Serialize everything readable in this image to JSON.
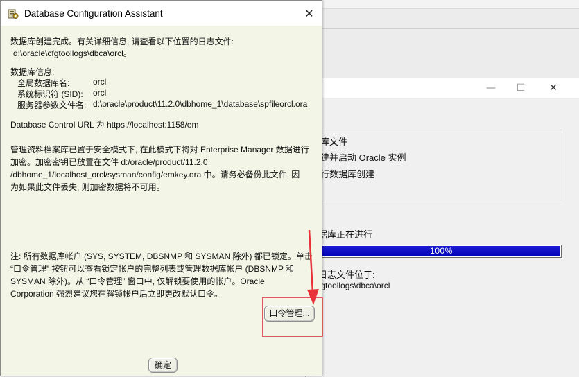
{
  "dialog": {
    "title": "Database Configuration Assistant",
    "line1": "数据库创建完成。有关详细信息, 请查看以下位置的日志文件:",
    "log_dir": "d:\\oracle\\cfgtoollogs\\dbca\\orcl。",
    "db_info_header": "数据库信息:",
    "global_db_name_label": "全局数据库名:",
    "global_db_name_value": "orcl",
    "sid_label": "系统标识符 (SID):",
    "sid_value": "orcl",
    "spfile_label": "服务器参数文件名:",
    "spfile_value": "d:\\oracle\\product\\11.2.0\\dbhome_1\\database\\spfileorcl.ora",
    "em_url": "Database Control URL 为 https://localhost:1158/em",
    "secure_lines": [
      "管理资料档案库已置于安全模式下, 在此模式下将对 Enterprise Manager 数据进行",
      "加密。加密密钥已放置在文件 d:/oracle/product/11.2.0",
      "/dbhome_1/localhost_orcl/sysman/config/emkey.ora 中。请务必备份此文件, 因",
      "为如果此文件丢失, 则加密数据将不可用。"
    ],
    "note_lines": [
      "注: 所有数据库帐户 (SYS, SYSTEM, DBSNMP 和 SYSMAN 除外) 都已锁定。单击",
      "“口令管理” 按钮可以查看锁定帐户的完整列表或管理数据库帐户 (DBSNMP 和",
      "SYSMAN 除外)。从 “口令管理” 窗口中, 仅解锁要使用的帐户。Oracle",
      "Corporation 强烈建议您在解锁帐户后立即更改默认口令。"
    ],
    "password_button": "口令管理...",
    "ok_button": "确定",
    "close_glyph": "✕"
  },
  "background_window": {
    "minimize_glyph": "—",
    "maximize_glyph": "☐",
    "close_glyph": "✕",
    "steps": [
      "库文件",
      "建并启动 Oracle 实例",
      "行数据库创建"
    ],
    "progress_label": "据库正在进行",
    "progress_value": 100,
    "progress_text": "100%",
    "log_label": "日志文件位于:",
    "log_path": "fgtoollogs\\dbca\\orcl"
  },
  "colors": {
    "dialog_bg": "#f3f5e6",
    "progress_fill": "#0000b8",
    "annotation_red": "#e0585c"
  },
  "icons": [
    "database-config-app-icon",
    "close-icon",
    "minimize-icon",
    "maximize-icon",
    "red-arrow-annotation"
  ]
}
